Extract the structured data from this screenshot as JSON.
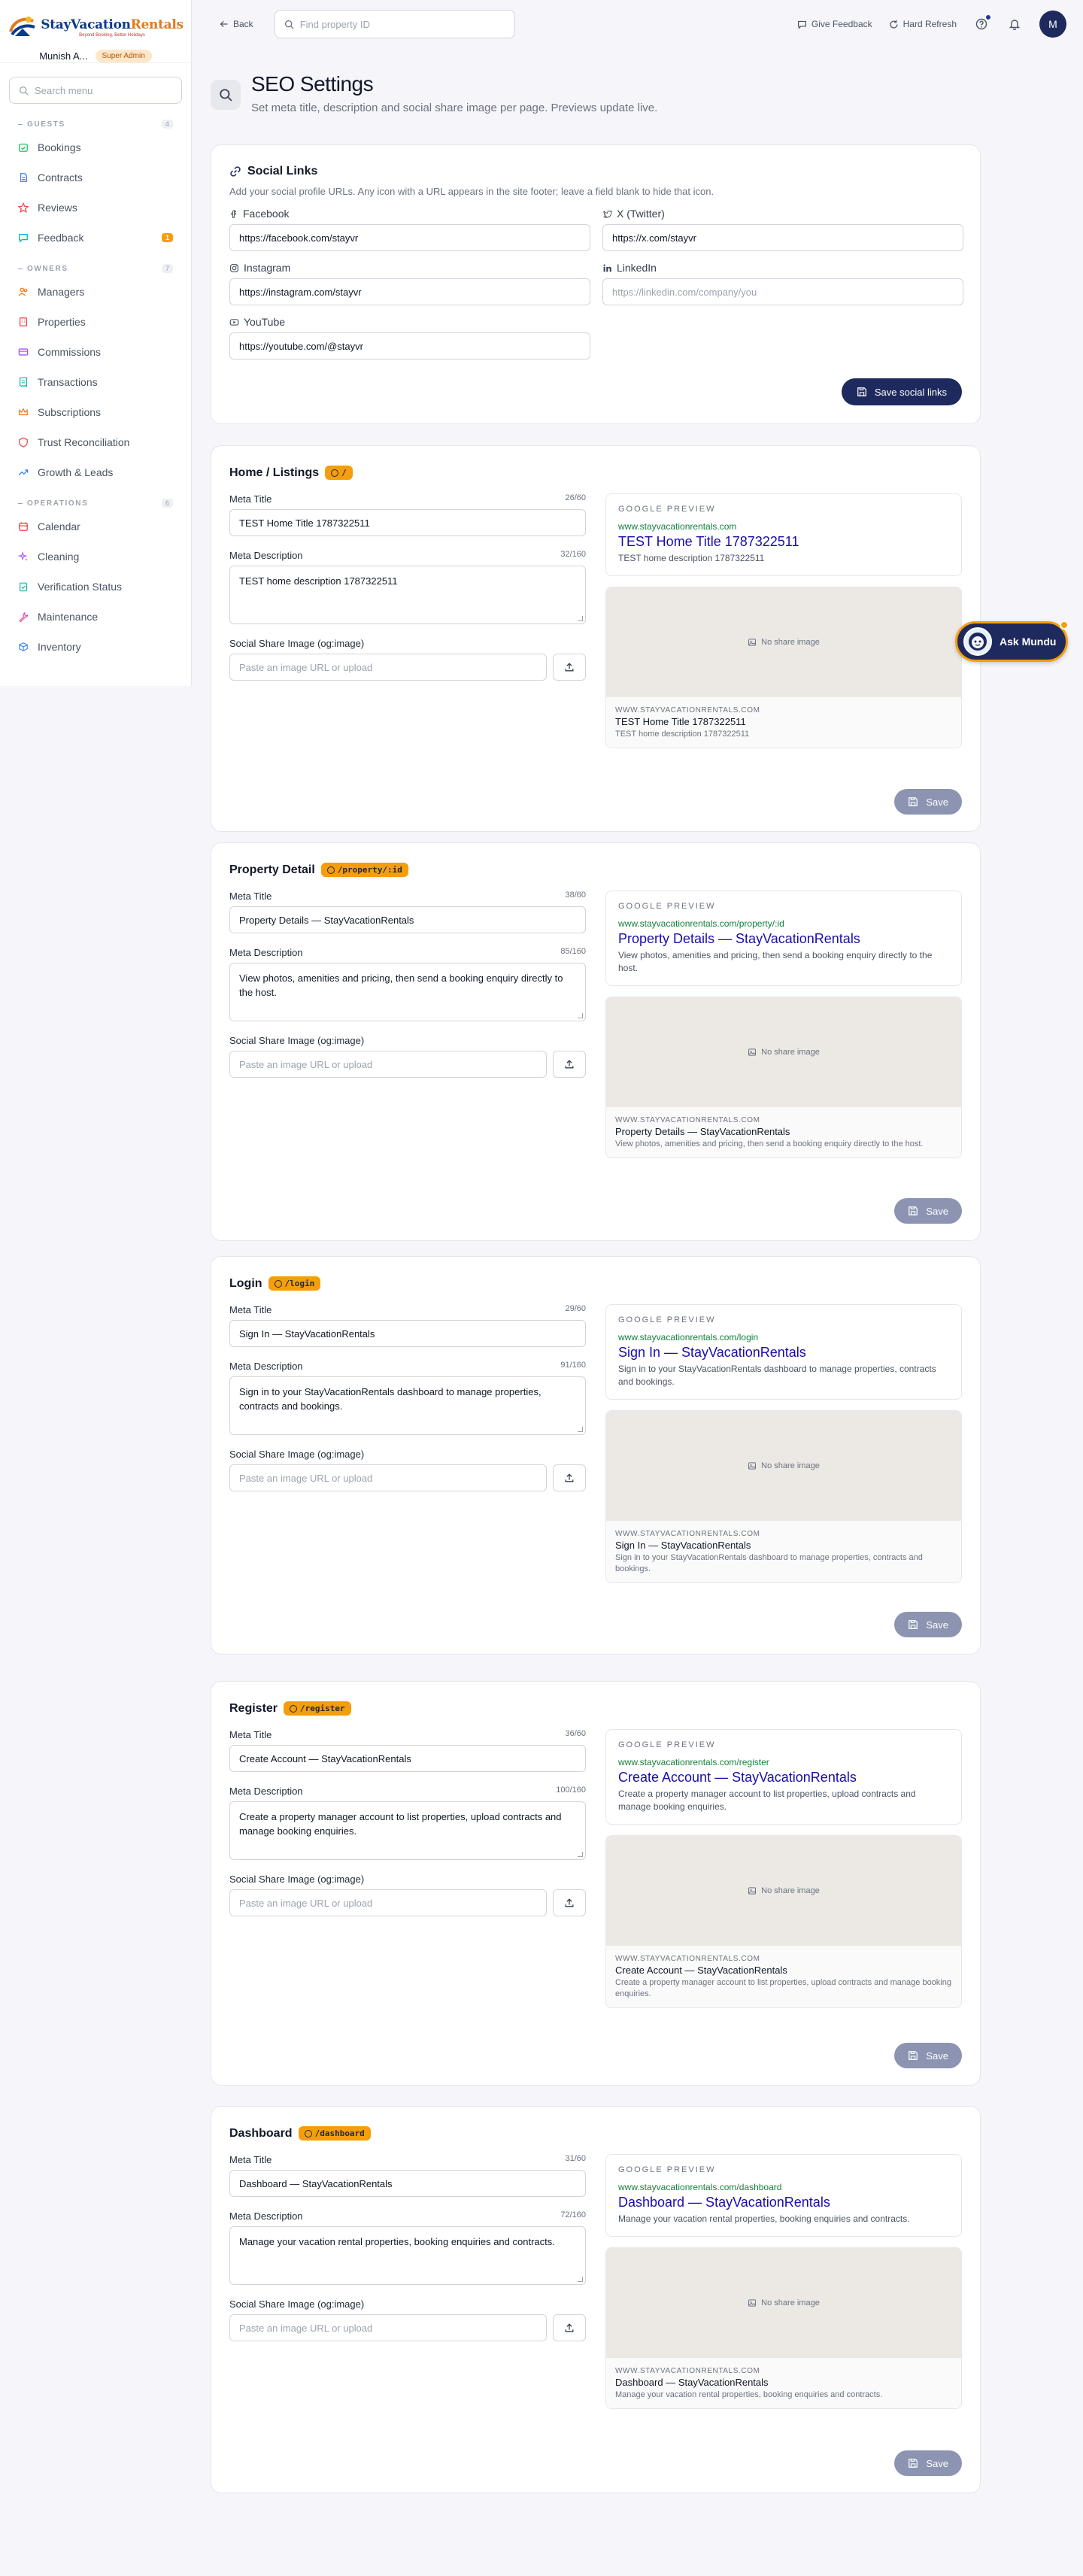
{
  "brand": {
    "name_main": "StayVacation",
    "name_accent": "Rentals",
    "tagline": "Beyond Booking, Better Holidays"
  },
  "user": {
    "name": "Munish A...",
    "role": "Super Admin"
  },
  "sidebar": {
    "search_placeholder": "Search menu",
    "sections": [
      {
        "title": "GUESTS",
        "count": "4",
        "items": [
          {
            "label": "Bookings",
            "icon": "calendar-check-icon",
            "color": "#22c55e"
          },
          {
            "label": "Contracts",
            "icon": "file-text-icon",
            "color": "#3b82f6"
          },
          {
            "label": "Reviews",
            "icon": "star-icon",
            "color": "#ef4444"
          },
          {
            "label": "Feedback",
            "icon": "message-icon",
            "color": "#06b6d4",
            "badge": "1"
          }
        ]
      },
      {
        "title": "OWNERS",
        "count": "7",
        "items": [
          {
            "label": "Managers",
            "icon": "users-icon",
            "color": "#f97316"
          },
          {
            "label": "Properties",
            "icon": "building-icon",
            "color": "#ef4444"
          },
          {
            "label": "Commissions",
            "icon": "credit-card-icon",
            "color": "#a855f7"
          },
          {
            "label": "Transactions",
            "icon": "receipt-icon",
            "color": "#14b8a6"
          },
          {
            "label": "Subscriptions",
            "icon": "crown-icon",
            "color": "#f97316"
          },
          {
            "label": "Trust Reconciliation",
            "icon": "shield-icon",
            "color": "#ef4444"
          },
          {
            "label": "Growth & Leads",
            "icon": "trending-up-icon",
            "color": "#3b82f6"
          }
        ]
      },
      {
        "title": "OPERATIONS",
        "count": "6",
        "items": [
          {
            "label": "Calendar",
            "icon": "calendar-icon",
            "color": "#ef4444"
          },
          {
            "label": "Cleaning",
            "icon": "sparkles-icon",
            "color": "#a855f7"
          },
          {
            "label": "Verification Status",
            "icon": "clipboard-check-icon",
            "color": "#14b8a6"
          },
          {
            "label": "Maintenance",
            "icon": "wrench-icon",
            "color": "#ec4899"
          },
          {
            "label": "Inventory",
            "icon": "box-icon",
            "color": "#3b82f6"
          }
        ]
      }
    ]
  },
  "topbar": {
    "back_label": "Back",
    "search_placeholder": "Find property ID",
    "feedback_label": "Give Feedback",
    "refresh_label": "Hard Refresh",
    "avatar_initial": "M"
  },
  "header": {
    "title": "SEO Settings",
    "subtitle": "Set meta title, description and social share image per page. Previews update live."
  },
  "social": {
    "title": "Social Links",
    "description": "Add your social profile URLs. Any icon with a URL appears in the site footer; leave a field blank to hide that icon.",
    "fields": [
      {
        "label": "Facebook",
        "icon": "facebook-icon",
        "value": "https://facebook.com/stayvr",
        "placeholder": ""
      },
      {
        "label": "X (Twitter)",
        "icon": "twitter-icon",
        "value": "https://x.com/stayvr",
        "placeholder": ""
      },
      {
        "label": "Instagram",
        "icon": "instagram-icon",
        "value": "https://instagram.com/stayvr",
        "placeholder": ""
      },
      {
        "label": "LinkedIn",
        "icon": "linkedin-icon",
        "value": "",
        "placeholder": "https://linkedin.com/company/you"
      },
      {
        "label": "YouTube",
        "icon": "youtube-icon",
        "value": "https://youtube.com/@stayvr",
        "placeholder": ""
      }
    ],
    "save_label": "Save social links"
  },
  "labels": {
    "meta_title": "Meta Title",
    "meta_description": "Meta Description",
    "share_image": "Social Share Image (og:image)",
    "share_placeholder": "Paste an image URL or upload",
    "google_preview": "GOOGLE PREVIEW",
    "no_share_image": "No share image",
    "og_domain": "WWW.STAYVACATIONRENTALS.COM",
    "save": "Save"
  },
  "pages": [
    {
      "name": "Home / Listings",
      "route": "/",
      "meta_title": "TEST Home Title 1787322511",
      "title_count": "26/60",
      "meta_description": "TEST home description 1787322511",
      "desc_count": "32/160",
      "url": "www.stayvacationrentals.com"
    },
    {
      "name": "Property Detail",
      "route": "/property/:id",
      "meta_title": "Property Details — StayVacationRentals",
      "title_count": "38/60",
      "meta_description": "View photos, amenities and pricing, then send a booking enquiry directly to the host.",
      "desc_count": "85/160",
      "url": "www.stayvacationrentals.com/property/:id"
    },
    {
      "name": "Login",
      "route": "/login",
      "meta_title": "Sign In — StayVacationRentals",
      "title_count": "29/60",
      "meta_description": "Sign in to your StayVacationRentals dashboard to manage properties, contracts and bookings.",
      "desc_count": "91/160",
      "url": "www.stayvacationrentals.com/login"
    },
    {
      "name": "Register",
      "route": "/register",
      "meta_title": "Create Account — StayVacationRentals",
      "title_count": "36/60",
      "meta_description": "Create a property manager account to list properties, upload contracts and manage booking enquiries.",
      "desc_count": "100/160",
      "url": "www.stayvacationrentals.com/register"
    },
    {
      "name": "Dashboard",
      "route": "/dashboard",
      "meta_title": "Dashboard — StayVacationRentals",
      "title_count": "31/60",
      "meta_description": "Manage your vacation rental properties, booking enquiries and contracts.",
      "desc_count": "72/160",
      "url": "www.stayvacationrentals.com/dashboard"
    }
  ],
  "assistant": {
    "label": "Ask Mundu"
  }
}
